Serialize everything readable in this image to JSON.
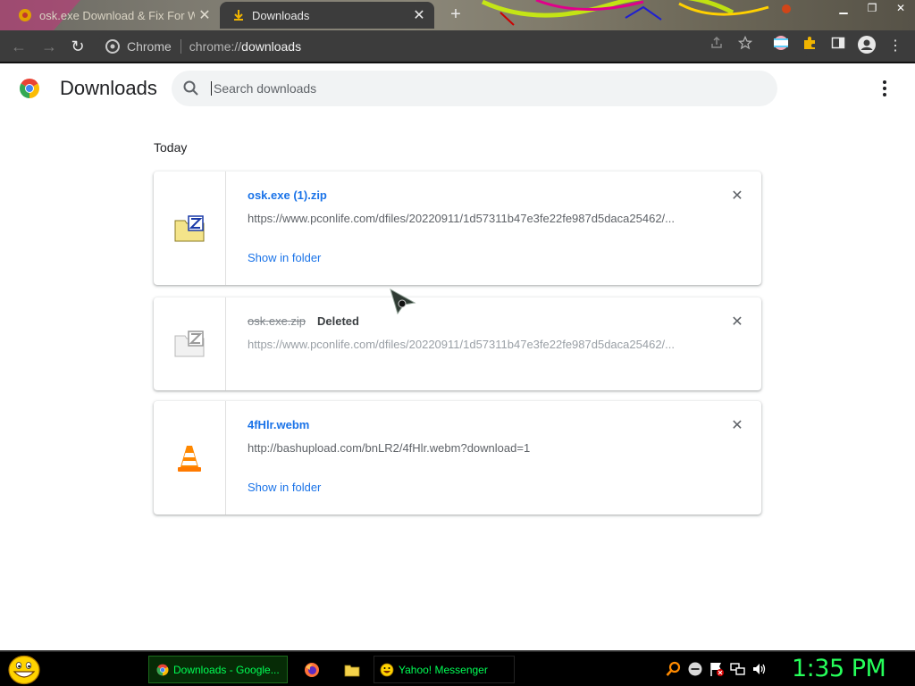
{
  "browser": {
    "tabs": [
      {
        "title": "osk.exe Download & Fix For Windows",
        "active": false
      },
      {
        "title": "Downloads",
        "active": true
      }
    ],
    "new_tab_label": "+",
    "omnibox": {
      "chip": "Chrome",
      "url_prefix": "chrome://",
      "url_host": "downloads"
    }
  },
  "page": {
    "title": "Downloads",
    "search_placeholder": "Search downloads",
    "section_label": "Today",
    "downloads": [
      {
        "name": "osk.exe (1).zip",
        "status": "",
        "url": "https://www.pconlife.com/dfiles/20220911/1d57311b47e3fe22fe987d5daca25462/...",
        "action": "Show in folder",
        "deleted": false,
        "icon": "zip-file-icon"
      },
      {
        "name": "osk.exe.zip",
        "status": "Deleted",
        "url": "https://www.pconlife.com/dfiles/20220911/1d57311b47e3fe22fe987d5daca25462/...",
        "action": "",
        "deleted": true,
        "icon": "zip-file-icon"
      },
      {
        "name": "4fHlr.webm",
        "status": "",
        "url": "http://bashupload.com/bnLR2/4fHlr.webm?download=1",
        "action": "Show in folder",
        "deleted": false,
        "icon": "vlc-cone-icon"
      }
    ],
    "colors": {
      "link": "#1a73e8",
      "text": "#202124",
      "muted": "#5f6368",
      "search_bg": "#f1f3f4"
    }
  },
  "taskbar": {
    "items": [
      {
        "label": "Downloads - Google...",
        "icon": "chrome-icon",
        "active": true
      },
      {
        "label": "",
        "icon": "firefox-icon"
      },
      {
        "label": "",
        "icon": "folder-icon"
      },
      {
        "label": "Yahoo! Messenger",
        "icon": "yahoo-smiley-icon"
      }
    ],
    "clock": "1:35 PM",
    "colors": {
      "text": "#00ff55",
      "background": "#000000"
    }
  }
}
